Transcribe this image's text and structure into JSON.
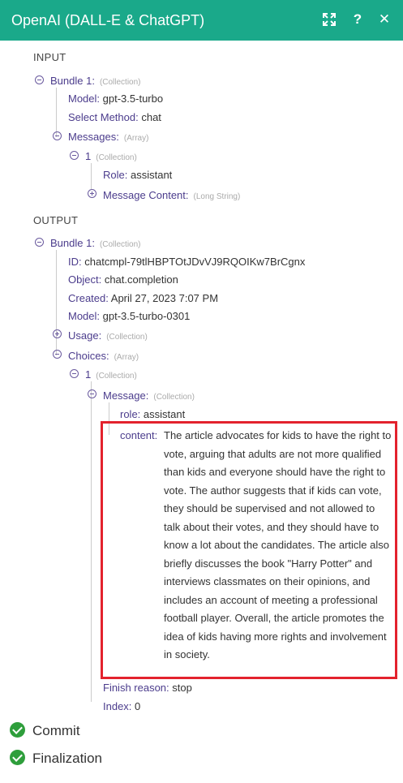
{
  "header": {
    "title": "OpenAI (DALL-E & ChatGPT)",
    "help_label": "?",
    "close_label": "✕"
  },
  "input": {
    "section_label": "INPUT",
    "bundle_label": "Bundle 1:",
    "bundle_type": "(Collection)",
    "model_key": "Model:",
    "model_value": "gpt-3.5-turbo",
    "method_key": "Select Method:",
    "method_value": "chat",
    "messages_key": "Messages:",
    "messages_type": "(Array)",
    "item_index": "1",
    "item_type": "(Collection)",
    "role_key": "Role:",
    "role_value": "assistant",
    "message_content_key": "Message Content:",
    "message_content_type": "(Long String)"
  },
  "output": {
    "section_label": "OUTPUT",
    "bundle_label": "Bundle 1:",
    "bundle_type": "(Collection)",
    "id_key": "ID:",
    "id_value": "chatcmpl-79tlHBPTOtJDvVJ9RQOIKw7BrCgnx",
    "object_key": "Object:",
    "object_value": "chat.completion",
    "created_key": "Created:",
    "created_value": "April 27, 2023 7:07 PM",
    "model_key": "Model:",
    "model_value": "gpt-3.5-turbo-0301",
    "usage_key": "Usage:",
    "usage_type": "(Collection)",
    "choices_key": "Choices:",
    "choices_type": "(Array)",
    "choice_index": "1",
    "choice_type": "(Collection)",
    "message_key": "Message:",
    "message_type": "(Collection)",
    "role_key": "role:",
    "role_value": "assistant",
    "content_key": "content:",
    "content_value": "The article advocates for kids to have the right to vote, arguing that adults are not more qualified than kids and everyone should have the right to vote. The author suggests that if kids can vote, they should be supervised and not allowed to talk about their votes, and they should have to know a lot about the candidates. The article also briefly discusses the book \"Harry Potter\" and interviews classmates on their opinions, and includes an account of meeting a professional football player. Overall, the article promotes the idea of kids having more rights and involvement in society.",
    "finish_key": "Finish reason:",
    "finish_value": "stop",
    "index_key": "Index:",
    "index_value": "0"
  },
  "status": {
    "commit_label": "Commit",
    "finalization_label": "Finalization"
  },
  "colors": {
    "header_bg": "#1aa98a",
    "key_text": "#4b3c8c",
    "highlight": "#e3222d",
    "success": "#2e9e3b"
  }
}
